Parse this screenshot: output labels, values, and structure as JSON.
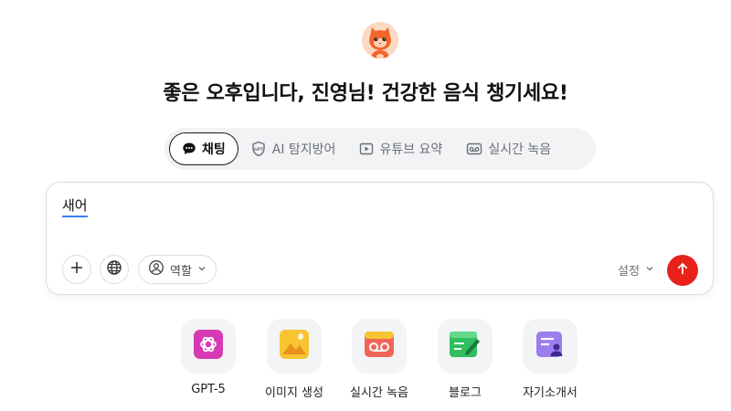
{
  "greeting": "좋은 오후입니다, 진영님! 건강한 음식 챙기세요!",
  "tabs": [
    {
      "label": "채팅",
      "icon": "chat-bubble-icon",
      "active": true
    },
    {
      "label": "AI 탐지방어",
      "icon": "gpt-shield-icon",
      "active": false
    },
    {
      "label": "유튜브 요약",
      "icon": "play-icon",
      "active": false
    },
    {
      "label": "실시간 녹음",
      "icon": "tape-recorder-icon",
      "active": false
    }
  ],
  "input": {
    "value": "새어"
  },
  "toolbar": {
    "role_label": "역할",
    "settings_label": "설정"
  },
  "shortcuts": [
    {
      "label": "GPT-5",
      "icon": "openai-icon"
    },
    {
      "label": "이미지 생성",
      "icon": "image-icon"
    },
    {
      "label": "실시간 녹음",
      "icon": "recorder-icon"
    },
    {
      "label": "블로그",
      "icon": "blog-pen-icon"
    },
    {
      "label": "자기소개서",
      "icon": "resume-icon"
    }
  ],
  "colors": {
    "accent": "#e8221b",
    "tab_bg": "#f2f3f5",
    "tile_bg": "#f3f4f6"
  }
}
